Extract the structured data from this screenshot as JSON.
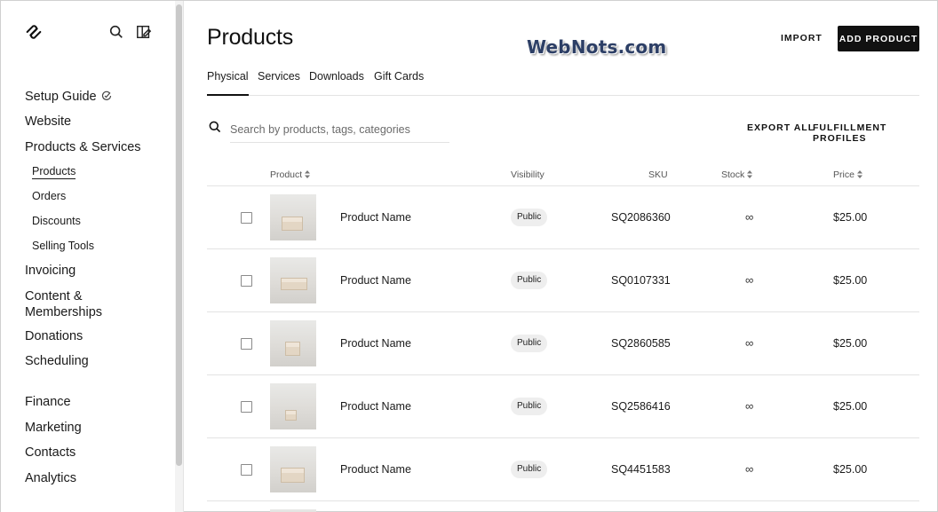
{
  "sidebar": {
    "items": [
      {
        "label": "Setup Guide",
        "icon": "setup-guide-icon"
      },
      {
        "label": "Website"
      },
      {
        "label": "Products & Services"
      },
      {
        "label": "Invoicing"
      },
      {
        "label": "Content &"
      },
      {
        "label": "Memberships"
      },
      {
        "label": "Donations"
      },
      {
        "label": "Scheduling"
      },
      {
        "label": "Finance"
      },
      {
        "label": "Marketing"
      },
      {
        "label": "Contacts"
      },
      {
        "label": "Analytics"
      }
    ],
    "sub_items": [
      {
        "label": "Products",
        "active": true
      },
      {
        "label": "Orders"
      },
      {
        "label": "Discounts"
      },
      {
        "label": "Selling Tools"
      }
    ]
  },
  "header": {
    "title": "Products",
    "watermark": "WebNots.com",
    "import_label": "IMPORT",
    "add_label": "ADD PRODUCT"
  },
  "tabs": [
    {
      "label": "Physical",
      "active": true
    },
    {
      "label": "Services"
    },
    {
      "label": "Downloads"
    },
    {
      "label": "Gift Cards"
    }
  ],
  "search": {
    "placeholder": "Search by products, tags, categories"
  },
  "actions": {
    "export_all": "EXPORT ALL",
    "fulfillment_profiles": "FULFILLMENT PROFILES"
  },
  "table": {
    "columns": {
      "product": "Product",
      "visibility": "Visibility",
      "sku": "SKU",
      "stock": "Stock",
      "price": "Price"
    },
    "rows": [
      {
        "name": "Product Name",
        "visibility": "Public",
        "sku": "SQ2086360",
        "stock": "∞",
        "price": "$25.00"
      },
      {
        "name": "Product Name",
        "visibility": "Public",
        "sku": "SQ0107331",
        "stock": "∞",
        "price": "$25.00"
      },
      {
        "name": "Product Name",
        "visibility": "Public",
        "sku": "SQ2860585",
        "stock": "∞",
        "price": "$25.00"
      },
      {
        "name": "Product Name",
        "visibility": "Public",
        "sku": "SQ2586416",
        "stock": "∞",
        "price": "$25.00"
      },
      {
        "name": "Product Name",
        "visibility": "Public",
        "sku": "SQ4451583",
        "stock": "∞",
        "price": "$25.00"
      }
    ]
  },
  "colors": {
    "accent": "#111111",
    "badge_bg": "#eeeeee",
    "divider": "#e3e3e3"
  }
}
